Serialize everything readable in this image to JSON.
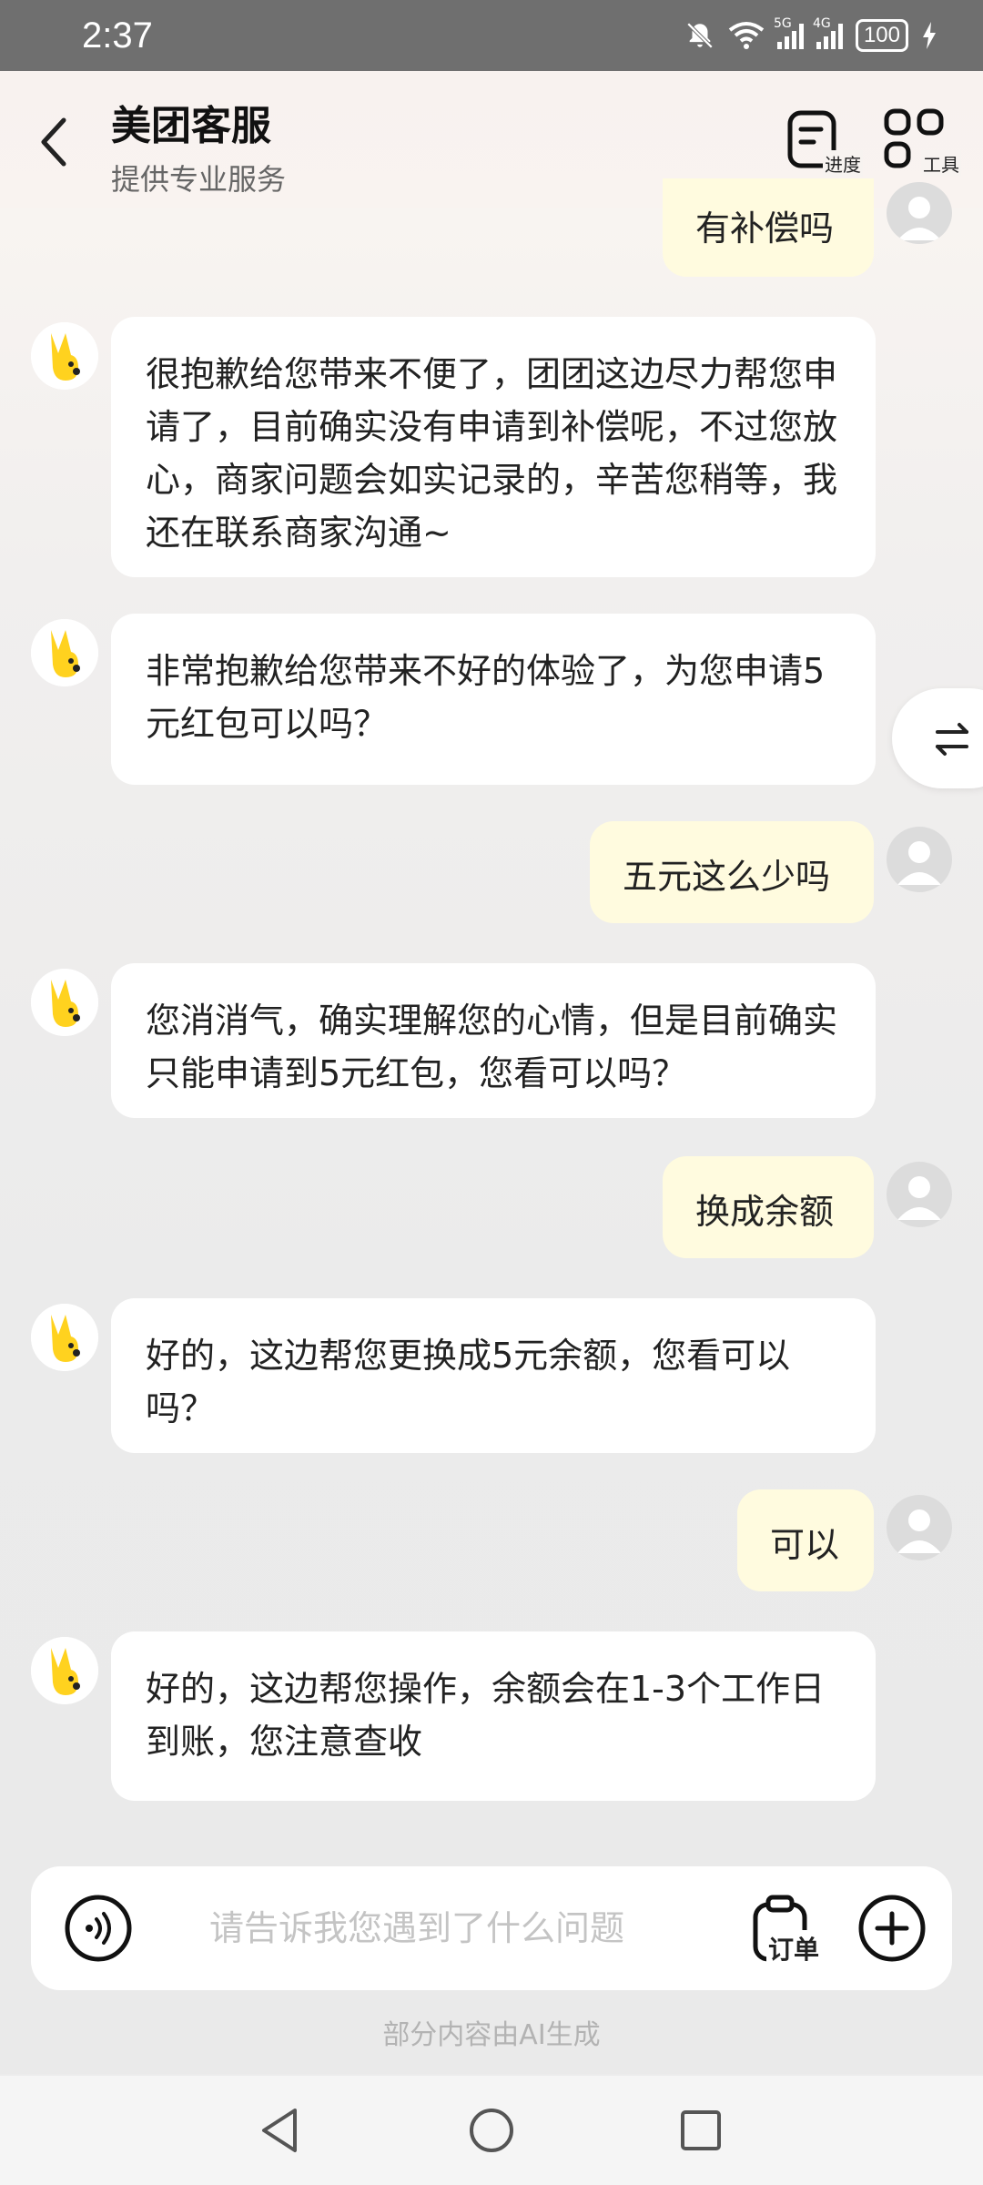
{
  "status_bar": {
    "time": "2:37",
    "net1": "5G",
    "net2": "4G",
    "battery": "100"
  },
  "header": {
    "title": "美团客服",
    "subtitle": "提供专业服务",
    "progress_label": "进度",
    "tools_label": "工具"
  },
  "messages": [
    {
      "role": "user",
      "text": "有补偿吗"
    },
    {
      "role": "bot",
      "text": "很抱歉给您带来不便了，团团这边尽力帮您申请了，目前确实没有申请到补偿呢，不过您放心，商家问题会如实记录的，辛苦您稍等，我还在联系商家沟通~"
    },
    {
      "role": "bot",
      "text": "非常抱歉给您带来不好的体验了，为您申请5元红包可以吗？"
    },
    {
      "role": "user",
      "text": "五元这么少吗"
    },
    {
      "role": "bot",
      "text": "您消消气，确实理解您的心情，但是目前确实只能申请到5元红包，您看可以吗？"
    },
    {
      "role": "user",
      "text": "换成余额"
    },
    {
      "role": "bot",
      "text": "好的，这边帮您更换成5元余额，您看可以吗？"
    },
    {
      "role": "user",
      "text": "可以"
    },
    {
      "role": "bot",
      "text": "好的，这边帮您操作，余额会在1-3个工作日到账，您注意查收"
    }
  ],
  "input": {
    "placeholder": "请告诉我您遇到了什么问题",
    "order_label": "订单"
  },
  "ai_note": "部分内容由AI生成",
  "colors": {
    "user_bubble": "#fffbdf",
    "bot_bubble": "#ffffff",
    "mascot": "#ffd21f"
  }
}
